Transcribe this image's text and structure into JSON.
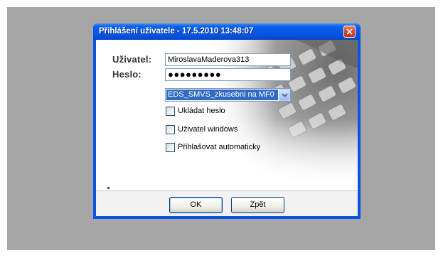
{
  "window": {
    "title": "Přihlášení uživatele - 17.5.2010 13:48:07"
  },
  "form": {
    "user_label": "Uživatel:",
    "user_value": "MiroslavaMaderova313",
    "password_label": "Heslo:",
    "password_value": "●●●●●●●●●",
    "database_value": "EDS_SMVS_zkusebni na MF0"
  },
  "options": {
    "save_password": "Ukládat heslo",
    "windows_user": "Uživatel windows",
    "auto_login": "Přihlašovat automaticky"
  },
  "buttons": {
    "ok": "OK",
    "back": "Zpět"
  },
  "colors": {
    "titlebar": "#0a54e3",
    "selection": "#316ac5",
    "background": "#a6a6a6"
  }
}
